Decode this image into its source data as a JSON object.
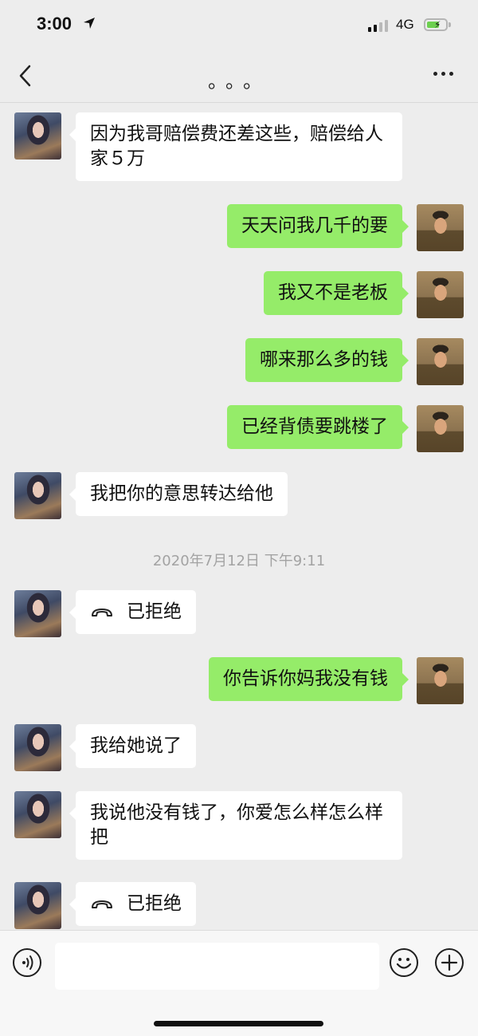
{
  "status_bar": {
    "time": "3:00",
    "network": "4G",
    "icons": [
      "location-arrow-icon",
      "signal-icon",
      "battery-charging-icon"
    ]
  },
  "nav": {
    "title": "。。。",
    "icons": [
      "back-chevron-icon",
      "more-dots-icon"
    ]
  },
  "messages": [
    {
      "from": "her",
      "text": "因为我哥赔偿费还差这些，赔偿给人家５万"
    },
    {
      "from": "him",
      "text": "天天问我几千的要"
    },
    {
      "from": "him",
      "text": "我又不是老板"
    },
    {
      "from": "him",
      "text": "哪来那么多的钱"
    },
    {
      "from": "him",
      "text": "已经背债要跳楼了"
    },
    {
      "from": "her",
      "text": "我把你的意思转达给他"
    },
    {
      "type": "timestamp",
      "text": "2020年7月12日 下午9:11"
    },
    {
      "from": "her",
      "type": "call",
      "icon": "phone-hangup-icon",
      "text": "已拒绝"
    },
    {
      "from": "him",
      "text": "你告诉你妈我没有钱"
    },
    {
      "from": "her",
      "text": "我给她说了"
    },
    {
      "from": "her",
      "text": "我说他没有钱了，你爱怎么样怎么样把"
    },
    {
      "from": "her",
      "type": "call",
      "icon": "phone-hangup-icon",
      "text": "已拒绝"
    }
  ],
  "input_bar": {
    "icons": [
      "voice-icon",
      "emoji-icon",
      "plus-icon"
    ],
    "placeholder": ""
  },
  "colors": {
    "background": "#ededed",
    "outgoing_bubble": "#95ec69",
    "incoming_bubble": "#ffffff",
    "timestamp_text": "#a3a3a3"
  }
}
